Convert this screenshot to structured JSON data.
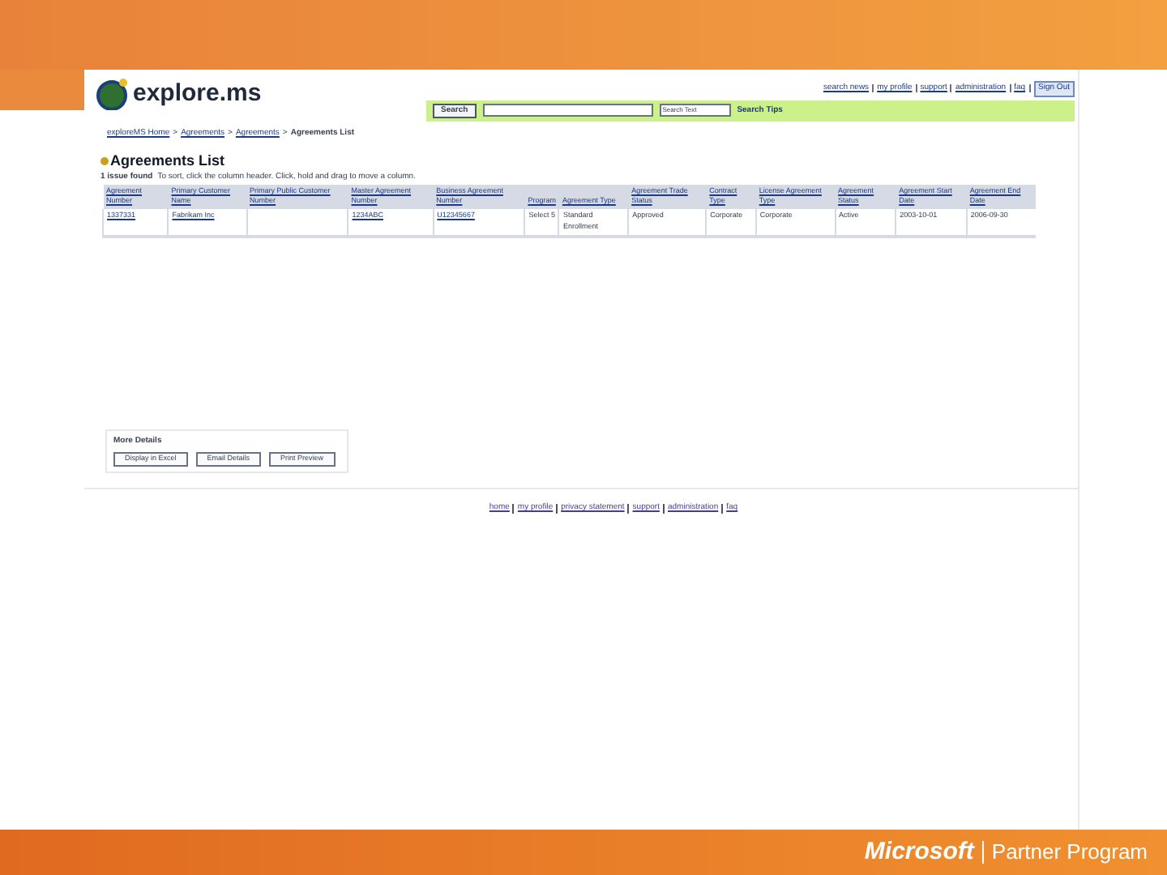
{
  "header": {
    "logo": "explore.ms",
    "links": [
      "search news",
      "my profile",
      "support",
      "administration",
      "faq"
    ],
    "sign_out": "Sign Out",
    "search_button": "Search",
    "scope": "Search Text",
    "search_tips": "Search Tips"
  },
  "breadcrumb": {
    "separator": ">",
    "items": [
      "exploreMS Home",
      "Agreements",
      "Agreements",
      "Agreements List"
    ]
  },
  "title": "Agreements List",
  "info": {
    "count": "1 issue found",
    "hint": "To sort, click the column header. Click, hold and drag to move a column."
  },
  "table": {
    "columns": [
      "Agreement Number",
      "Primary Customer Name",
      "Primary Public Customer Number",
      "Master Agreement Number",
      "Business Agreement Number",
      "Program",
      "Agreement Type",
      "Agreement Trade Status",
      "Contract Type",
      "License Agreement Type",
      "Agreement Status",
      "Agreement Start Date",
      "Agreement End Date"
    ],
    "rows": [
      {
        "cells": [
          {
            "text": "1337331",
            "link": true
          },
          {
            "text": "Fabrikam Inc",
            "link": true
          },
          {},
          {
            "text": "1234ABC",
            "link": true
          },
          {
            "text": "U12345667",
            "link": true
          },
          {
            "text": "Select 5",
            "link": false
          },
          {
            "text": "Standard Enrollment",
            "link": false
          },
          {
            "text": "Approved",
            "link": false
          },
          {
            "text": "Corporate",
            "link": false
          },
          {
            "text": "Corporate",
            "link": false
          },
          {
            "text": "Active",
            "link": false
          },
          {
            "text": "2003-10-01",
            "link": false
          },
          {
            "text": "2006-09-30",
            "link": false
          }
        ]
      }
    ]
  },
  "more_details": {
    "title": "More Details",
    "buttons": [
      "Display in Excel",
      "Email Details",
      "Print Preview"
    ]
  },
  "footer_links": [
    "home",
    "my profile",
    "privacy statement",
    "support",
    "administration",
    "faq"
  ],
  "brand": {
    "name": "Microsoft",
    "program": "Partner Program"
  }
}
